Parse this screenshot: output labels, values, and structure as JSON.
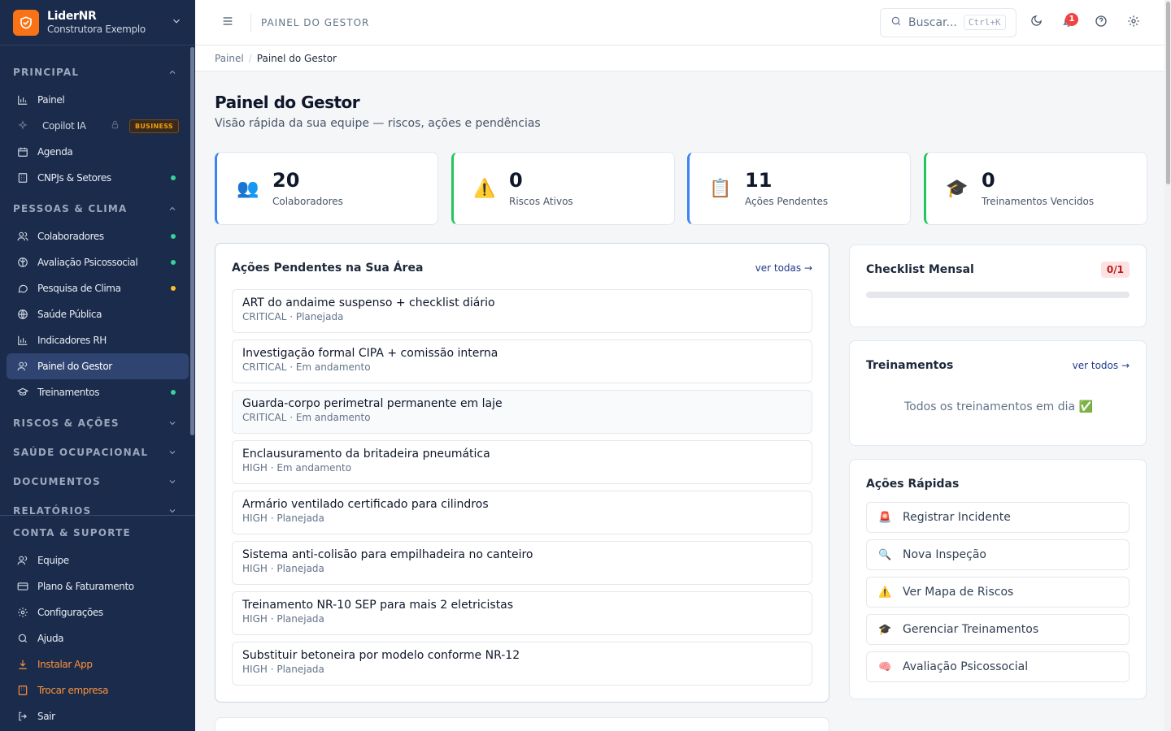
{
  "brand": {
    "name": "LiderNR",
    "company": "Construtora Exemplo"
  },
  "sidebar": {
    "sections": {
      "principal": "PRINCIPAL",
      "pessoas": "PESSOAS & CLIMA",
      "riscos": "RISCOS & AÇÕES",
      "saude": "SAÚDE OCUPACIONAL",
      "documentos": "DOCUMENTOS",
      "relatorios": "RELATÓRIOS",
      "conta": "CONTA & SUPORTE"
    },
    "items": {
      "painel": "Painel",
      "copilot": "Copilot IA",
      "copilot_badge": "BUSINESS",
      "agenda": "Agenda",
      "cnpjs": "CNPJs & Setores",
      "colaboradores": "Colaboradores",
      "avaliacao": "Avaliação Psicossocial",
      "pesquisa": "Pesquisa de Clima",
      "saude_publica": "Saúde Pública",
      "indicadores": "Indicadores RH",
      "painel_gestor": "Painel do Gestor",
      "treinamentos": "Treinamentos",
      "equipe": "Equipe",
      "plano": "Plano & Faturamento",
      "config": "Configurações",
      "ajuda": "Ajuda",
      "instalar": "Instalar App",
      "trocar": "Trocar empresa",
      "sair": "Sair"
    }
  },
  "topbar": {
    "title": "PAINEL DO GESTOR",
    "search_placeholder": "Buscar...",
    "search_shortcut": "Ctrl+K",
    "notifications": "1"
  },
  "breadcrumb": {
    "root": "Painel",
    "sep": "/",
    "current": "Painel do Gestor"
  },
  "page": {
    "title": "Painel do Gestor",
    "subtitle": "Visão rápida da sua equipe — riscos, ações e pendências"
  },
  "stats": [
    {
      "value": "20",
      "label": "Colaboradores",
      "icon": "👥",
      "color": "#3b82f6"
    },
    {
      "value": "0",
      "label": "Riscos Ativos",
      "icon": "⚠️",
      "color": "#22c55e"
    },
    {
      "value": "11",
      "label": "Ações Pendentes",
      "icon": "📋",
      "color": "#3b82f6"
    },
    {
      "value": "0",
      "label": "Treinamentos Vencidos",
      "icon": "🎓",
      "color": "#22c55e"
    }
  ],
  "acoes": {
    "title": "Ações Pendentes na Sua Área",
    "link": "ver todas →",
    "items": [
      {
        "title": "ART do andaime suspenso + checklist diário",
        "meta": "CRITICAL · Planejada"
      },
      {
        "title": "Investigação formal CIPA + comissão interna",
        "meta": "CRITICAL · Em andamento"
      },
      {
        "title": "Guarda-corpo perimetral permanente em laje",
        "meta": "CRITICAL · Em andamento"
      },
      {
        "title": "Enclausuramento da britadeira pneumática",
        "meta": "HIGH · Em andamento"
      },
      {
        "title": "Armário ventilado certificado para cilindros",
        "meta": "HIGH · Planejada"
      },
      {
        "title": "Sistema anti-colisão para empilhadeira no canteiro",
        "meta": "HIGH · Planejada"
      },
      {
        "title": "Treinamento NR-10 SEP para mais 2 eletricistas",
        "meta": "HIGH · Planejada"
      },
      {
        "title": "Substituir betoneira por modelo conforme NR-12",
        "meta": "HIGH · Planejada"
      }
    ]
  },
  "checklist": {
    "title": "Checklist Mensal",
    "badge": "0/1",
    "progress": 0
  },
  "treinamentos": {
    "title": "Treinamentos",
    "link": "ver todos →",
    "empty": "Todos os treinamentos em dia ✅"
  },
  "quick": {
    "title": "Ações Rápidas",
    "items": [
      {
        "label": "Registrar Incidente",
        "icon": "🚨"
      },
      {
        "label": "Nova Inspeção",
        "icon": "🔍"
      },
      {
        "label": "Ver Mapa de Riscos",
        "icon": "⚠️"
      },
      {
        "label": "Gerenciar Treinamentos",
        "icon": "🎓"
      },
      {
        "label": "Avaliação Psicossocial",
        "icon": "🧠"
      }
    ]
  }
}
